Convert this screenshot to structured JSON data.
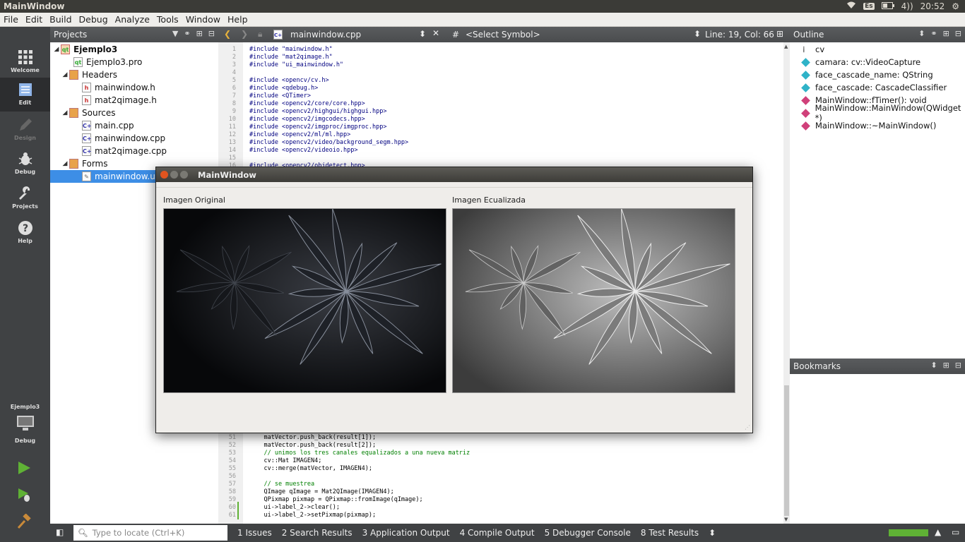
{
  "topbar": {
    "title": "MainWindow",
    "keyboard": "Es",
    "volume": "4))",
    "time": "20:52"
  },
  "menu": [
    "File",
    "Edit",
    "Build",
    "Debug",
    "Analyze",
    "Tools",
    "Window",
    "Help"
  ],
  "modes": [
    {
      "label": "Welcome"
    },
    {
      "label": "Edit"
    },
    {
      "label": "Design"
    },
    {
      "label": "Debug"
    },
    {
      "label": "Projects"
    },
    {
      "label": "Help"
    }
  ],
  "kit": {
    "project": "Ejemplo3",
    "mode": "Debug"
  },
  "projects": {
    "header": "Projects",
    "root": "Ejemplo3",
    "pro": "Ejemplo3.pro",
    "headers": {
      "label": "Headers",
      "files": [
        "mainwindow.h",
        "mat2qimage.h"
      ]
    },
    "sources": {
      "label": "Sources",
      "files": [
        "main.cpp",
        "mainwindow.cpp",
        "mat2qimage.cpp"
      ]
    },
    "forms": {
      "label": "Forms",
      "files": [
        "mainwindow.ui"
      ]
    }
  },
  "editor": {
    "file": "mainwindow.cpp",
    "symbol": "<Select Symbol>",
    "position": "Line: 19, Col: 66",
    "top_lines": [
      {
        "n": "1",
        "t": "#include \"mainwindow.h\""
      },
      {
        "n": "2",
        "t": "#include \"mat2qimage.h\""
      },
      {
        "n": "3",
        "t": "#include \"ui_mainwindow.h\""
      },
      {
        "n": "4",
        "t": ""
      },
      {
        "n": "5",
        "t": "#include <opencv/cv.h>"
      },
      {
        "n": "6",
        "t": "#include <qdebug.h>"
      },
      {
        "n": "7",
        "t": "#include <QTimer>"
      },
      {
        "n": "8",
        "t": "#include <opencv2/core/core.hpp>"
      },
      {
        "n": "9",
        "t": "#include <opencv2/highgui/highgui.hpp>"
      },
      {
        "n": "10",
        "t": "#include <opencv2/imgcodecs.hpp>"
      },
      {
        "n": "11",
        "t": "#include <opencv2/imgproc/imgproc.hpp>"
      },
      {
        "n": "12",
        "t": "#include <opencv2/ml/ml.hpp>"
      },
      {
        "n": "13",
        "t": "#include <opencv2/video/background_segm.hpp>"
      },
      {
        "n": "14",
        "t": "#include <opencv2/videoio.hpp>"
      },
      {
        "n": "15",
        "t": ""
      },
      {
        "n": "16",
        "t": "#include <opencv2/objdetect.hpp>"
      }
    ],
    "bottom_lines": [
      {
        "n": "51",
        "t": "    matVector.push_back(result[1]);"
      },
      {
        "n": "52",
        "t": "    matVector.push_back(result[2]);"
      },
      {
        "n": "53",
        "t": "    // unimos los tres canales equalizados a una nueva matriz"
      },
      {
        "n": "54",
        "t": "    cv::Mat IMAGEN4;"
      },
      {
        "n": "55",
        "t": "    cv::merge(matVector, IMAGEN4);"
      },
      {
        "n": "56",
        "t": ""
      },
      {
        "n": "57",
        "t": "    // se muestrea"
      },
      {
        "n": "58",
        "t": "    QImage qImage = Mat2QImage(IMAGEN4);"
      },
      {
        "n": "59",
        "t": "    QPixmap pixmap = QPixmap::fromImage(qImage);"
      },
      {
        "n": "60",
        "t": "    ui->label_2->clear();"
      },
      {
        "n": "61",
        "t": "    ui->label_2->setPixmap(pixmap);"
      }
    ]
  },
  "outline": {
    "header": "Outline",
    "items": [
      {
        "label": "cv",
        "color": ""
      },
      {
        "label": "camara: cv::VideoCapture",
        "color": "#2fb3c8"
      },
      {
        "label": "face_cascade_name: QString",
        "color": "#2fb3c8"
      },
      {
        "label": "face_cascade: CascadeClassifier",
        "color": "#2fb3c8"
      },
      {
        "label": "MainWindow::fTimer(): void",
        "color": "#d0407a"
      },
      {
        "label": "MainWindow::MainWindow(QWidget *)",
        "color": "#d0407a"
      },
      {
        "label": "MainWindow::~MainWindow()",
        "color": "#d0407a"
      }
    ]
  },
  "bookmarks": {
    "header": "Bookmarks"
  },
  "statusbar": {
    "locate_placeholder": "Type to locate (Ctrl+K)",
    "tabs": [
      "1  Issues",
      "2  Search Results",
      "3  Application Output",
      "4  Compile Output",
      "5  Debugger Console",
      "8  Test Results"
    ]
  },
  "dialog": {
    "title": "MainWindow",
    "label_original": "Imagen Original",
    "label_equalized": "Imagen Ecualizada"
  }
}
